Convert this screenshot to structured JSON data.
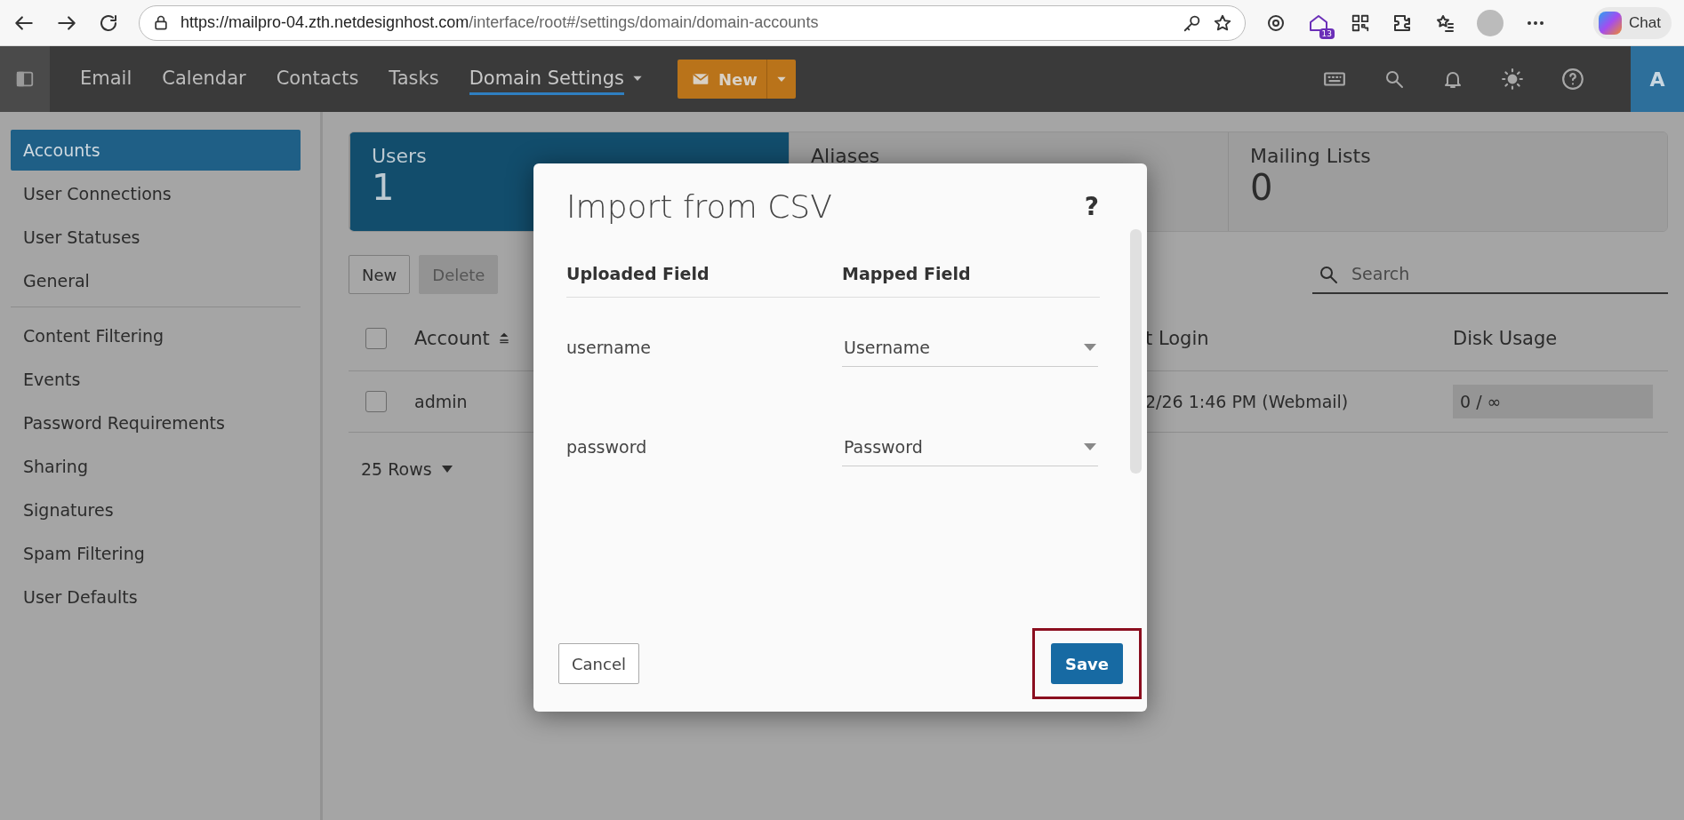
{
  "browser": {
    "url_host": "https://mailpro-04.zth.netdesignhost.com",
    "url_path": "/interface/root#/settings/domain/domain-accounts",
    "badge": "13",
    "chat_label": "Chat"
  },
  "nav": {
    "items": [
      {
        "label": "Email",
        "selected": false
      },
      {
        "label": "Calendar",
        "selected": false
      },
      {
        "label": "Contacts",
        "selected": false
      },
      {
        "label": "Tasks",
        "selected": false
      },
      {
        "label": "Domain Settings",
        "selected": true
      }
    ],
    "new_button": "New",
    "avatar": "A"
  },
  "sidebar": {
    "groups": [
      [
        {
          "label": "Accounts",
          "selected": true
        },
        {
          "label": "User Connections",
          "selected": false
        },
        {
          "label": "User Statuses",
          "selected": false
        },
        {
          "label": "General",
          "selected": false
        }
      ],
      [
        {
          "label": "Content Filtering",
          "selected": false
        },
        {
          "label": "Events",
          "selected": false
        },
        {
          "label": "Password Requirements",
          "selected": false
        },
        {
          "label": "Sharing",
          "selected": false
        },
        {
          "label": "Signatures",
          "selected": false
        },
        {
          "label": "Spam Filtering",
          "selected": false
        },
        {
          "label": "User Defaults",
          "selected": false
        }
      ]
    ]
  },
  "cards": [
    {
      "label": "Users",
      "count": "1",
      "selected": true
    },
    {
      "label": "Aliases",
      "selected": false
    },
    {
      "label": "Mailing Lists",
      "count": "0",
      "selected": false
    }
  ],
  "toolbar": {
    "buttons": [
      {
        "label": "New",
        "disabled": false
      },
      {
        "label": "Delete",
        "disabled": true
      }
    ],
    "search": {
      "placeholder": "Search"
    }
  },
  "table": {
    "header_checked": false,
    "columns": [
      {
        "label": "Account",
        "sorted": true
      },
      {
        "label": "t Login",
        "sorted": false
      },
      {
        "label": "Disk Usage",
        "sorted": false
      }
    ],
    "rows": [
      {
        "checked": false,
        "cells": [
          "admin",
          "2/26 1:46 PM (Webmail)",
          "0 / ∞"
        ]
      }
    ],
    "rows_selector": "25 Rows"
  },
  "dialog": {
    "title": "Import from CSV",
    "help": "?",
    "columns": [
      "Uploaded Field",
      "Mapped Field"
    ],
    "mappings": [
      {
        "field": "username",
        "value": "Username"
      },
      {
        "field": "password",
        "value": "Password"
      }
    ],
    "cancel": "Cancel",
    "save": "Save",
    "save_highlighted": true
  }
}
